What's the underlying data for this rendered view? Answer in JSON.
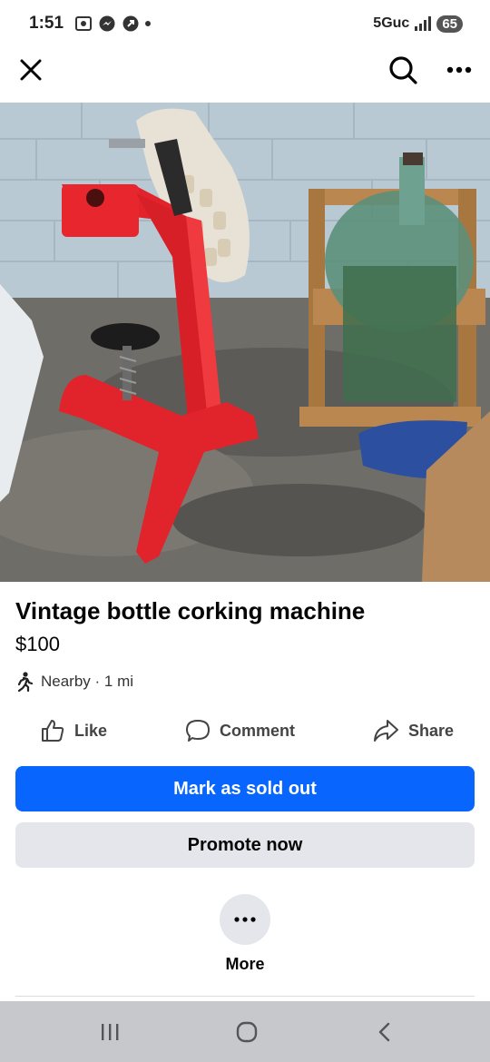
{
  "status_bar": {
    "time": "1:51",
    "network": "5Guc",
    "battery": "65"
  },
  "listing": {
    "title": "Vintage bottle corking machine",
    "price": "$100",
    "location": "Nearby · 1 mi"
  },
  "actions": {
    "like": "Like",
    "comment": "Comment",
    "share": "Share"
  },
  "buttons": {
    "mark_sold": "Mark as sold out",
    "promote": "Promote now",
    "more": "More"
  },
  "colors": {
    "primary": "#0866ff",
    "secondary_bg": "#e4e6eb"
  }
}
